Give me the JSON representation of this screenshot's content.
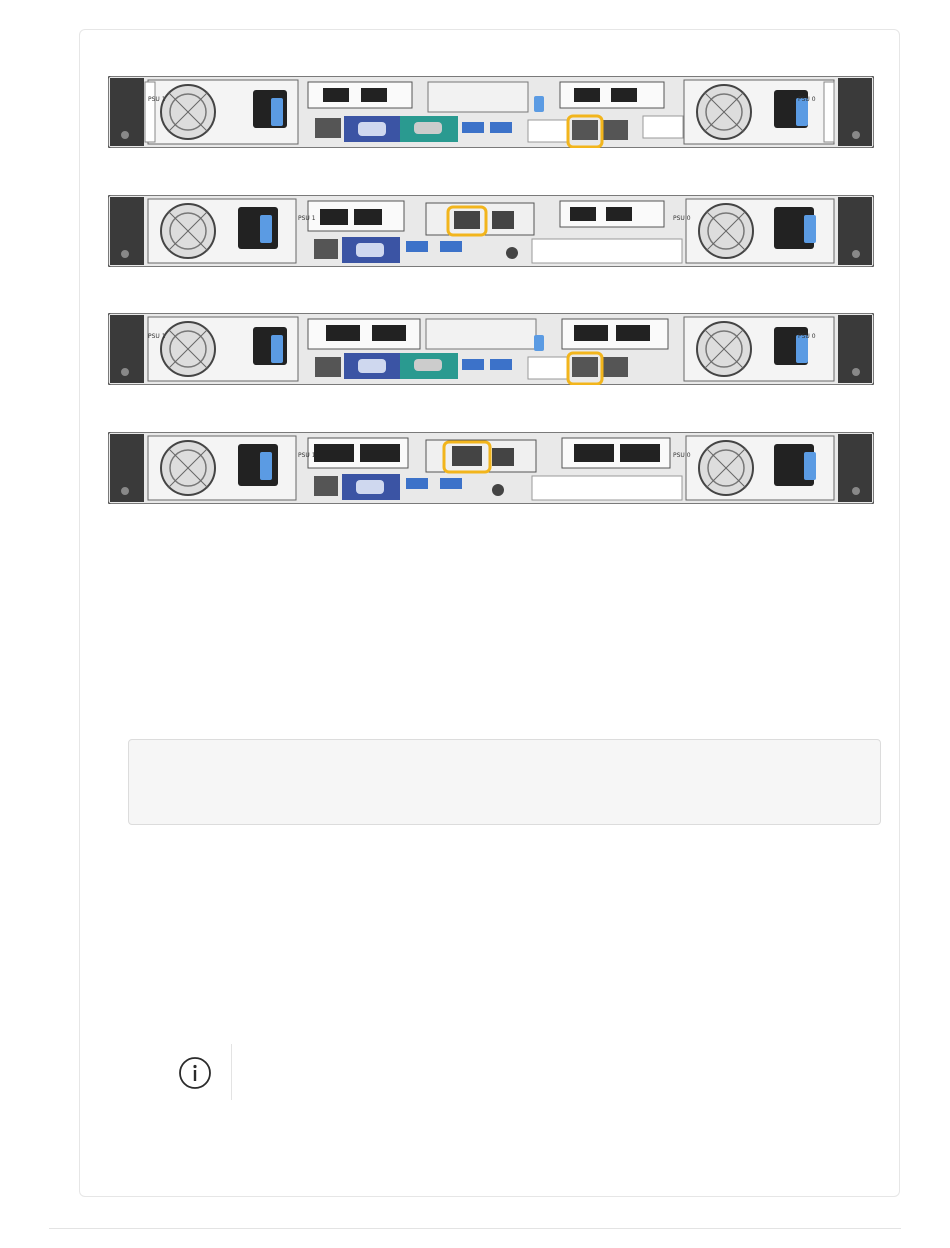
{
  "document": {
    "figures": [
      {
        "id": "appliance-1",
        "left_psu_label": "PSU 1",
        "right_psu_label": "PSU 0",
        "highlighted": "rear management port"
      },
      {
        "id": "appliance-2",
        "left_psu_label": "PSU 1",
        "right_psu_label": "PSU 0",
        "highlighted": "rear management port"
      },
      {
        "id": "appliance-3",
        "left_psu_label": "PSU 1",
        "right_psu_label": "PSU 0",
        "highlighted": "rear management port"
      },
      {
        "id": "appliance-4",
        "left_psu_label": "PSU 1",
        "right_psu_label": "PSU 0",
        "highlighted": "rear management port"
      }
    ],
    "code_block": "",
    "note_text": ""
  },
  "colors": {
    "highlight": "#f2b51c",
    "vga_blue": "#3b54a4",
    "serial_teal": "#2a9a90",
    "usb_blue": "#3c72c9",
    "latch_blue": "#5b9be3",
    "chassis_dark": "#3a3a3a",
    "chassis_light": "#eeeeee"
  },
  "icons": {
    "note": "info-icon"
  }
}
